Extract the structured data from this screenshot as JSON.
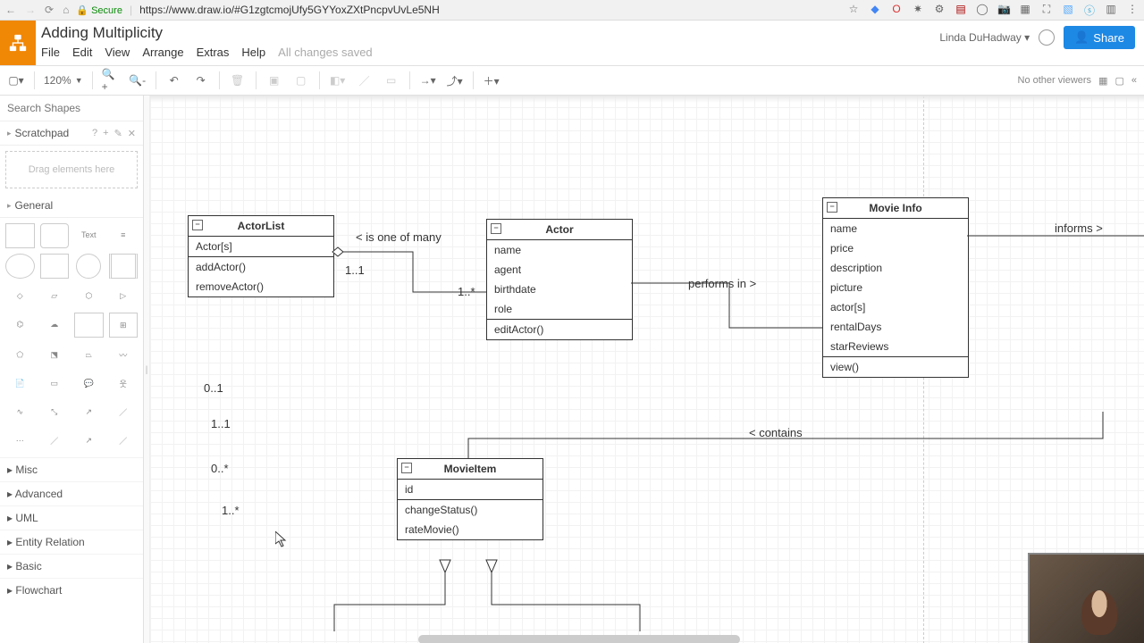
{
  "browser": {
    "secure_label": "Secure",
    "url_display": "https://www.draw.io/#G1zgtcmojUfy5GYYoxZXtPncpvUvLe5NH"
  },
  "header": {
    "doc_title": "Adding Multiplicity",
    "menus": {
      "file": "File",
      "edit": "Edit",
      "view": "View",
      "arrange": "Arrange",
      "extras": "Extras",
      "help": "Help"
    },
    "save_status": "All changes saved",
    "user": "Linda DuHadway",
    "share": "Share"
  },
  "toolbar": {
    "zoom": "120%",
    "no_viewers": "No other viewers"
  },
  "sidebar": {
    "search_placeholder": "Search Shapes",
    "scratchpad": "Scratchpad",
    "scratch_drop": "Drag elements here",
    "general": "General",
    "text_shape": "Text",
    "cats": {
      "misc": "Misc",
      "advanced": "Advanced",
      "uml": "UML",
      "entity": "Entity Relation",
      "basic": "Basic",
      "flowchart": "Flowchart"
    }
  },
  "diagram": {
    "actorlist": {
      "title": "ActorList",
      "attrs": [
        "Actor[s]"
      ],
      "ops": [
        "addActor()",
        "removeActor()"
      ]
    },
    "actor": {
      "title": "Actor",
      "attrs": [
        "name",
        "agent",
        "birthdate",
        "role"
      ],
      "ops": [
        "editActor()"
      ]
    },
    "movieinfo": {
      "title": "Movie Info",
      "attrs": [
        "name",
        "price",
        "description",
        "picture",
        "actor[s]",
        "rentalDays",
        "starReviews"
      ],
      "ops": [
        "view()"
      ]
    },
    "movieitem": {
      "title": "MovieItem",
      "attrs": [
        "id"
      ],
      "ops": [
        "changeStatus()",
        "rateMovie()"
      ]
    },
    "rel": {
      "isoneofmany": "< is one of many",
      "m11": "1..1",
      "m1s": "1..*",
      "performs": "performs in >",
      "contains": "< contains",
      "informs": "informs >"
    },
    "floating": {
      "a": "0..1",
      "b": "1..1",
      "c": "0..*",
      "d": "1..*"
    }
  }
}
